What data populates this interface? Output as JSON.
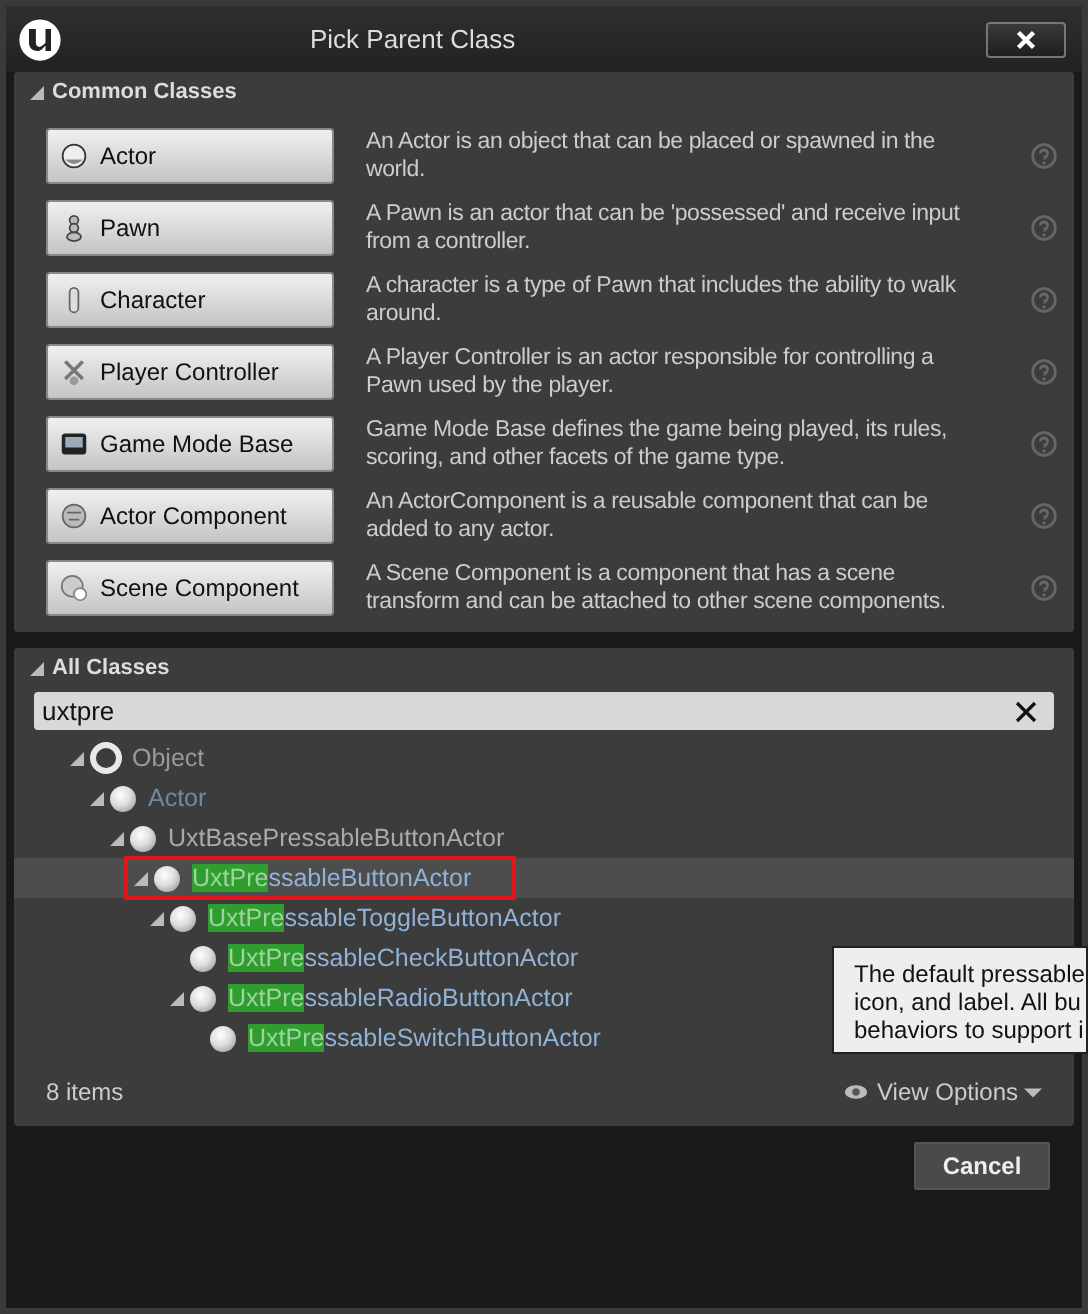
{
  "window": {
    "title": "Pick Parent Class"
  },
  "common_classes": {
    "title": "Common Classes",
    "expanded": true,
    "items": [
      {
        "kind": "actor",
        "label": "Actor",
        "description": "An Actor is an object that can be placed or spawned in the world."
      },
      {
        "kind": "pawn",
        "label": "Pawn",
        "description": "A Pawn is an actor that can be 'possessed' and receive input from a controller."
      },
      {
        "kind": "character",
        "label": "Character",
        "description": "A character is a type of Pawn that includes the ability to walk around."
      },
      {
        "kind": "controller",
        "label": "Player Controller",
        "description": "A Player Controller is an actor responsible for controlling a Pawn used by the player."
      },
      {
        "kind": "gamemode",
        "label": "Game Mode Base",
        "description": "Game Mode Base defines the game being played, its rules, scoring, and other facets of the game type."
      },
      {
        "kind": "component",
        "label": "Actor Component",
        "description": "An ActorComponent is a reusable component that can be added to any actor."
      },
      {
        "kind": "scene",
        "label": "Scene Component",
        "description": "A Scene Component is a component that has a scene transform and can be attached to other scene components."
      }
    ]
  },
  "all_classes": {
    "title": "All Classes",
    "expanded": true,
    "search": {
      "value": "uxtpre"
    },
    "tree": [
      {
        "kind": "root",
        "name": "Object",
        "expanded": true,
        "selected": false,
        "children": [
          {
            "kind": "muted",
            "name": "Actor",
            "expanded": true,
            "selected": false,
            "children": [
              {
                "kind": "plain",
                "name": "UxtBasePressableButtonActor",
                "expanded": true,
                "selected": false,
                "children": [
                  {
                    "kind": "match",
                    "highlight": "UxtPre",
                    "name": "ssableButtonActor",
                    "expanded": true,
                    "selected": true,
                    "children": [
                      {
                        "kind": "match",
                        "highlight": "UxtPre",
                        "name": "ssableToggleButtonActor",
                        "expanded": true,
                        "selected": false,
                        "children": [
                          {
                            "kind": "match",
                            "highlight": "UxtPre",
                            "name": "ssableCheckButtonActor",
                            "selected": false
                          },
                          {
                            "kind": "match",
                            "highlight": "UxtPre",
                            "name": "ssableRadioButtonActor",
                            "expanded": true,
                            "selected": false,
                            "children": [
                              {
                                "kind": "match",
                                "highlight": "UxtPre",
                                "name": "ssableSwitchButtonActor",
                                "selected": false
                              }
                            ]
                          }
                        ]
                      }
                    ]
                  }
                ]
              }
            ]
          }
        ]
      }
    ],
    "item_count": "8 items",
    "view_options": "View Options",
    "tooltip": {
      "lines": [
        "The default pressable",
        "icon, and label. All bu",
        "behaviors to support i"
      ]
    }
  },
  "buttons": [
    "Cancel"
  ]
}
